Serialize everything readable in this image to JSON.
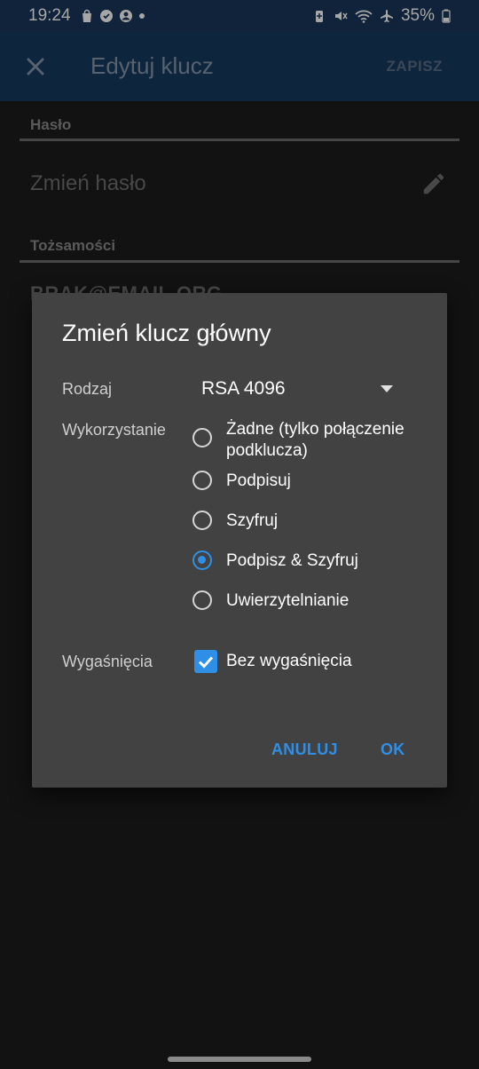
{
  "status_bar": {
    "time": "19:24",
    "battery": "35%",
    "left_icons": [
      "shopping-bag-icon",
      "shield-icon",
      "account-circle-icon",
      "dot-icon"
    ],
    "right_icons": [
      "battery-saver-icon",
      "mute-icon",
      "wifi-icon",
      "airplane-icon",
      "battery-icon"
    ]
  },
  "app_bar": {
    "title": "Edytuj klucz",
    "save_label": "ZAPISZ"
  },
  "background": {
    "password_section": "Hasło",
    "change_password": "Zmień hasło",
    "identities_section": "Tożsamości",
    "email": "BRAK@EMAIL.ORG"
  },
  "dialog": {
    "title": "Zmień klucz główny",
    "type_label": "Rodzaj",
    "type_value": "RSA 4096",
    "usage_label": "Wykorzystanie",
    "usage_options": [
      {
        "label": "Żadne (tylko połączenie podklucza)",
        "checked": false
      },
      {
        "label": "Podpisuj",
        "checked": false
      },
      {
        "label": "Szyfruj",
        "checked": false
      },
      {
        "label": "Podpisz & Szyfruj",
        "checked": true
      },
      {
        "label": "Uwierzytelnianie",
        "checked": false
      }
    ],
    "expiry_label": "Wygaśnięcia",
    "expiry_checkbox_label": "Bez wygaśnięcia",
    "expiry_checked": true,
    "cancel_label": "ANULUJ",
    "ok_label": "OK"
  },
  "colors": {
    "accent": "#2f8ee6",
    "app_bar": "#163a60",
    "dialog_bg": "#424242",
    "page_bg": "#1c1c1c"
  }
}
